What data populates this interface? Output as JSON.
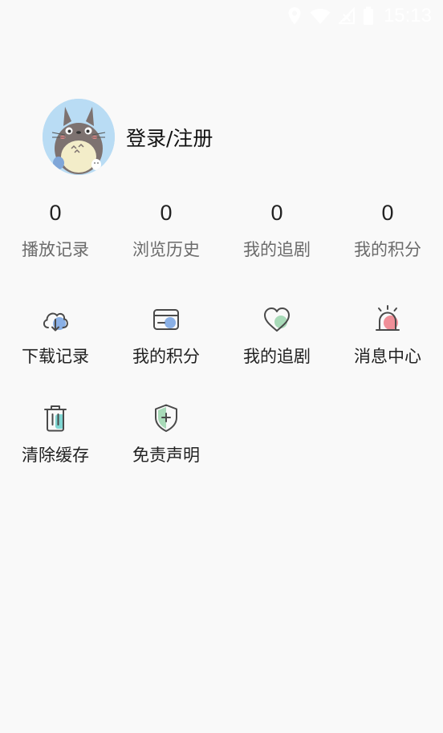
{
  "status_bar": {
    "time": "15:13",
    "icons": [
      "location-icon",
      "wifi-icon",
      "no-signal-icon",
      "battery-icon"
    ]
  },
  "profile": {
    "avatar_icon": "totoro-avatar",
    "login_label": "登录/注册"
  },
  "stats": [
    {
      "value": "0",
      "label": "播放记录"
    },
    {
      "value": "0",
      "label": "浏览历史"
    },
    {
      "value": "0",
      "label": "我的追剧"
    },
    {
      "value": "0",
      "label": "我的积分"
    }
  ],
  "menu": [
    {
      "icon": "cloud-download-icon",
      "label": "下载记录"
    },
    {
      "icon": "wallet-card-icon",
      "label": "我的积分"
    },
    {
      "icon": "heart-icon",
      "label": "我的追剧"
    },
    {
      "icon": "alarm-light-icon",
      "label": "消息中心"
    },
    {
      "icon": "trash-icon",
      "label": "清除缓存"
    },
    {
      "icon": "shield-plus-icon",
      "label": "免责声明"
    }
  ],
  "colors": {
    "background": "#f9f9f9",
    "accent_blue": "#8ab0e6",
    "accent_green": "#a8dab8",
    "accent_pink": "#f08f98",
    "accent_teal": "#7fd6d2",
    "icon_stroke": "#4a4a4a"
  }
}
